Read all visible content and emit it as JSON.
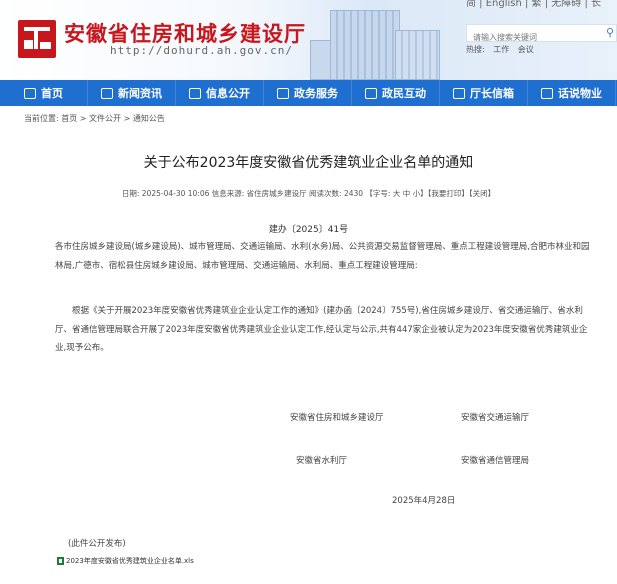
{
  "header": {
    "site_title": "安徽省住房和城乡建设厅",
    "site_url": "http://dohurd.ah.gov.cn/",
    "top_links": "简  |  English  |  繁  |  无障碍  |  长",
    "search_placeholder": "请输入搜索关键词",
    "hot_label": "热搜:",
    "hot_items": [
      "工作",
      "会议"
    ]
  },
  "nav": {
    "items": [
      {
        "label": "首页",
        "icon": "home-icon"
      },
      {
        "label": "新闻资讯",
        "icon": "news-icon"
      },
      {
        "label": "信息公开",
        "icon": "info-icon"
      },
      {
        "label": "政务服务",
        "icon": "service-icon"
      },
      {
        "label": "政民互动",
        "icon": "interaction-icon"
      },
      {
        "label": "厅长信箱",
        "icon": "mailbox-icon"
      },
      {
        "label": "话说物业",
        "icon": "chat-icon"
      }
    ]
  },
  "breadcrumb": "当前位置: 首页 > 文件公开 > 通知公告",
  "article": {
    "title": "关于公布2023年度安徽省优秀建筑业企业名单的通知",
    "meta": "日期: 2025-04-30 10:06    信息来源: 省住房城乡建设厅    阅读次数: 2430    【字号: 大 中 小】【我要打印】【关闭】",
    "doc_no": "建办〔2025〕41号",
    "recipients": "各市住房城乡建设局(城乡建设局)、城市管理局、交通运输局、水利(水务)局、公共资源交易监督管理局、重点工程建设管理局,合肥市林业和园林局,广德市、宿松县住房城乡建设局、城市管理局、交通运输局、水利局、重点工程建设管理局:",
    "body": "根据《关于开展2023年度安徽省优秀建筑业企业认定工作的通知》(建办函〔2024〕755号),省住房城乡建设厅、省交通运输厅、省水利厅、省通信管理局联合开展了2023年度安徽省优秀建筑业企业认定工作,经认定与公示,共有447家企业被认定为2023年度安徽省优秀建筑业企业,现予公布。",
    "signatures": [
      "安徽省住房和城乡建设厅",
      "安徽省交通运输厅",
      "安徽省水利厅",
      "安徽省通信管理局"
    ],
    "date": "2025年4月28日",
    "note": "(此件公开发布)",
    "attachment": "2023年度安徽省优秀建筑业企业名单.xls"
  }
}
